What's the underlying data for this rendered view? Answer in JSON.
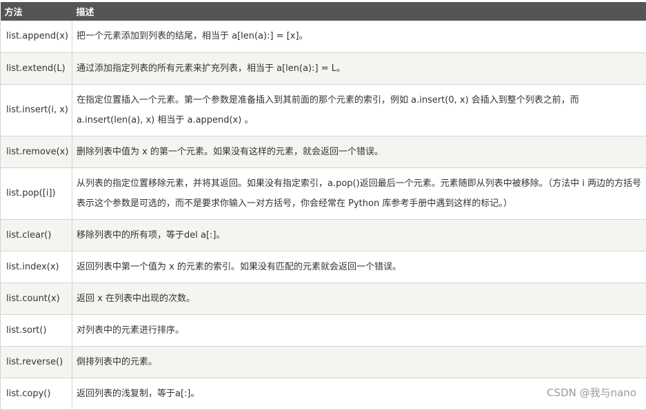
{
  "table": {
    "headers": [
      "方法",
      "描述"
    ],
    "rows": [
      {
        "method": "list.append(x)",
        "desc": "把一个元素添加到列表的结尾，相当于 a[len(a):] = [x]。"
      },
      {
        "method": "list.extend(L)",
        "desc": "通过添加指定列表的所有元素来扩充列表，相当于 a[len(a):] = L。"
      },
      {
        "method": "list.insert(i, x)",
        "desc": "在指定位置插入一个元素。第一个参数是准备插入到其前面的那个元素的索引，例如 a.insert(0, x) 会插入到整个列表之前，而 a.insert(len(a), x) 相当于 a.append(x) 。"
      },
      {
        "method": "list.remove(x)",
        "desc": "删除列表中值为 x 的第一个元素。如果没有这样的元素，就会返回一个错误。"
      },
      {
        "method": "list.pop([i])",
        "desc": "从列表的指定位置移除元素，并将其返回。如果没有指定索引，a.pop()返回最后一个元素。元素随即从列表中被移除。（方法中 i 两边的方括号表示这个参数是可选的，而不是要求你输入一对方括号，你会经常在 Python 库参考手册中遇到这样的标记。）"
      },
      {
        "method": "list.clear()",
        "desc": "移除列表中的所有项，等于del a[:]。"
      },
      {
        "method": "list.index(x)",
        "desc": "返回列表中第一个值为 x 的元素的索引。如果没有匹配的元素就会返回一个错误。"
      },
      {
        "method": "list.count(x)",
        "desc": "返回 x 在列表中出现的次数。"
      },
      {
        "method": "list.sort()",
        "desc": "对列表中的元素进行排序。"
      },
      {
        "method": "list.reverse()",
        "desc": "倒排列表中的元素。"
      },
      {
        "method": "list.copy()",
        "desc": "返回列表的浅复制，等于a[:]。"
      }
    ]
  },
  "watermark": "CSDN @我与nano"
}
